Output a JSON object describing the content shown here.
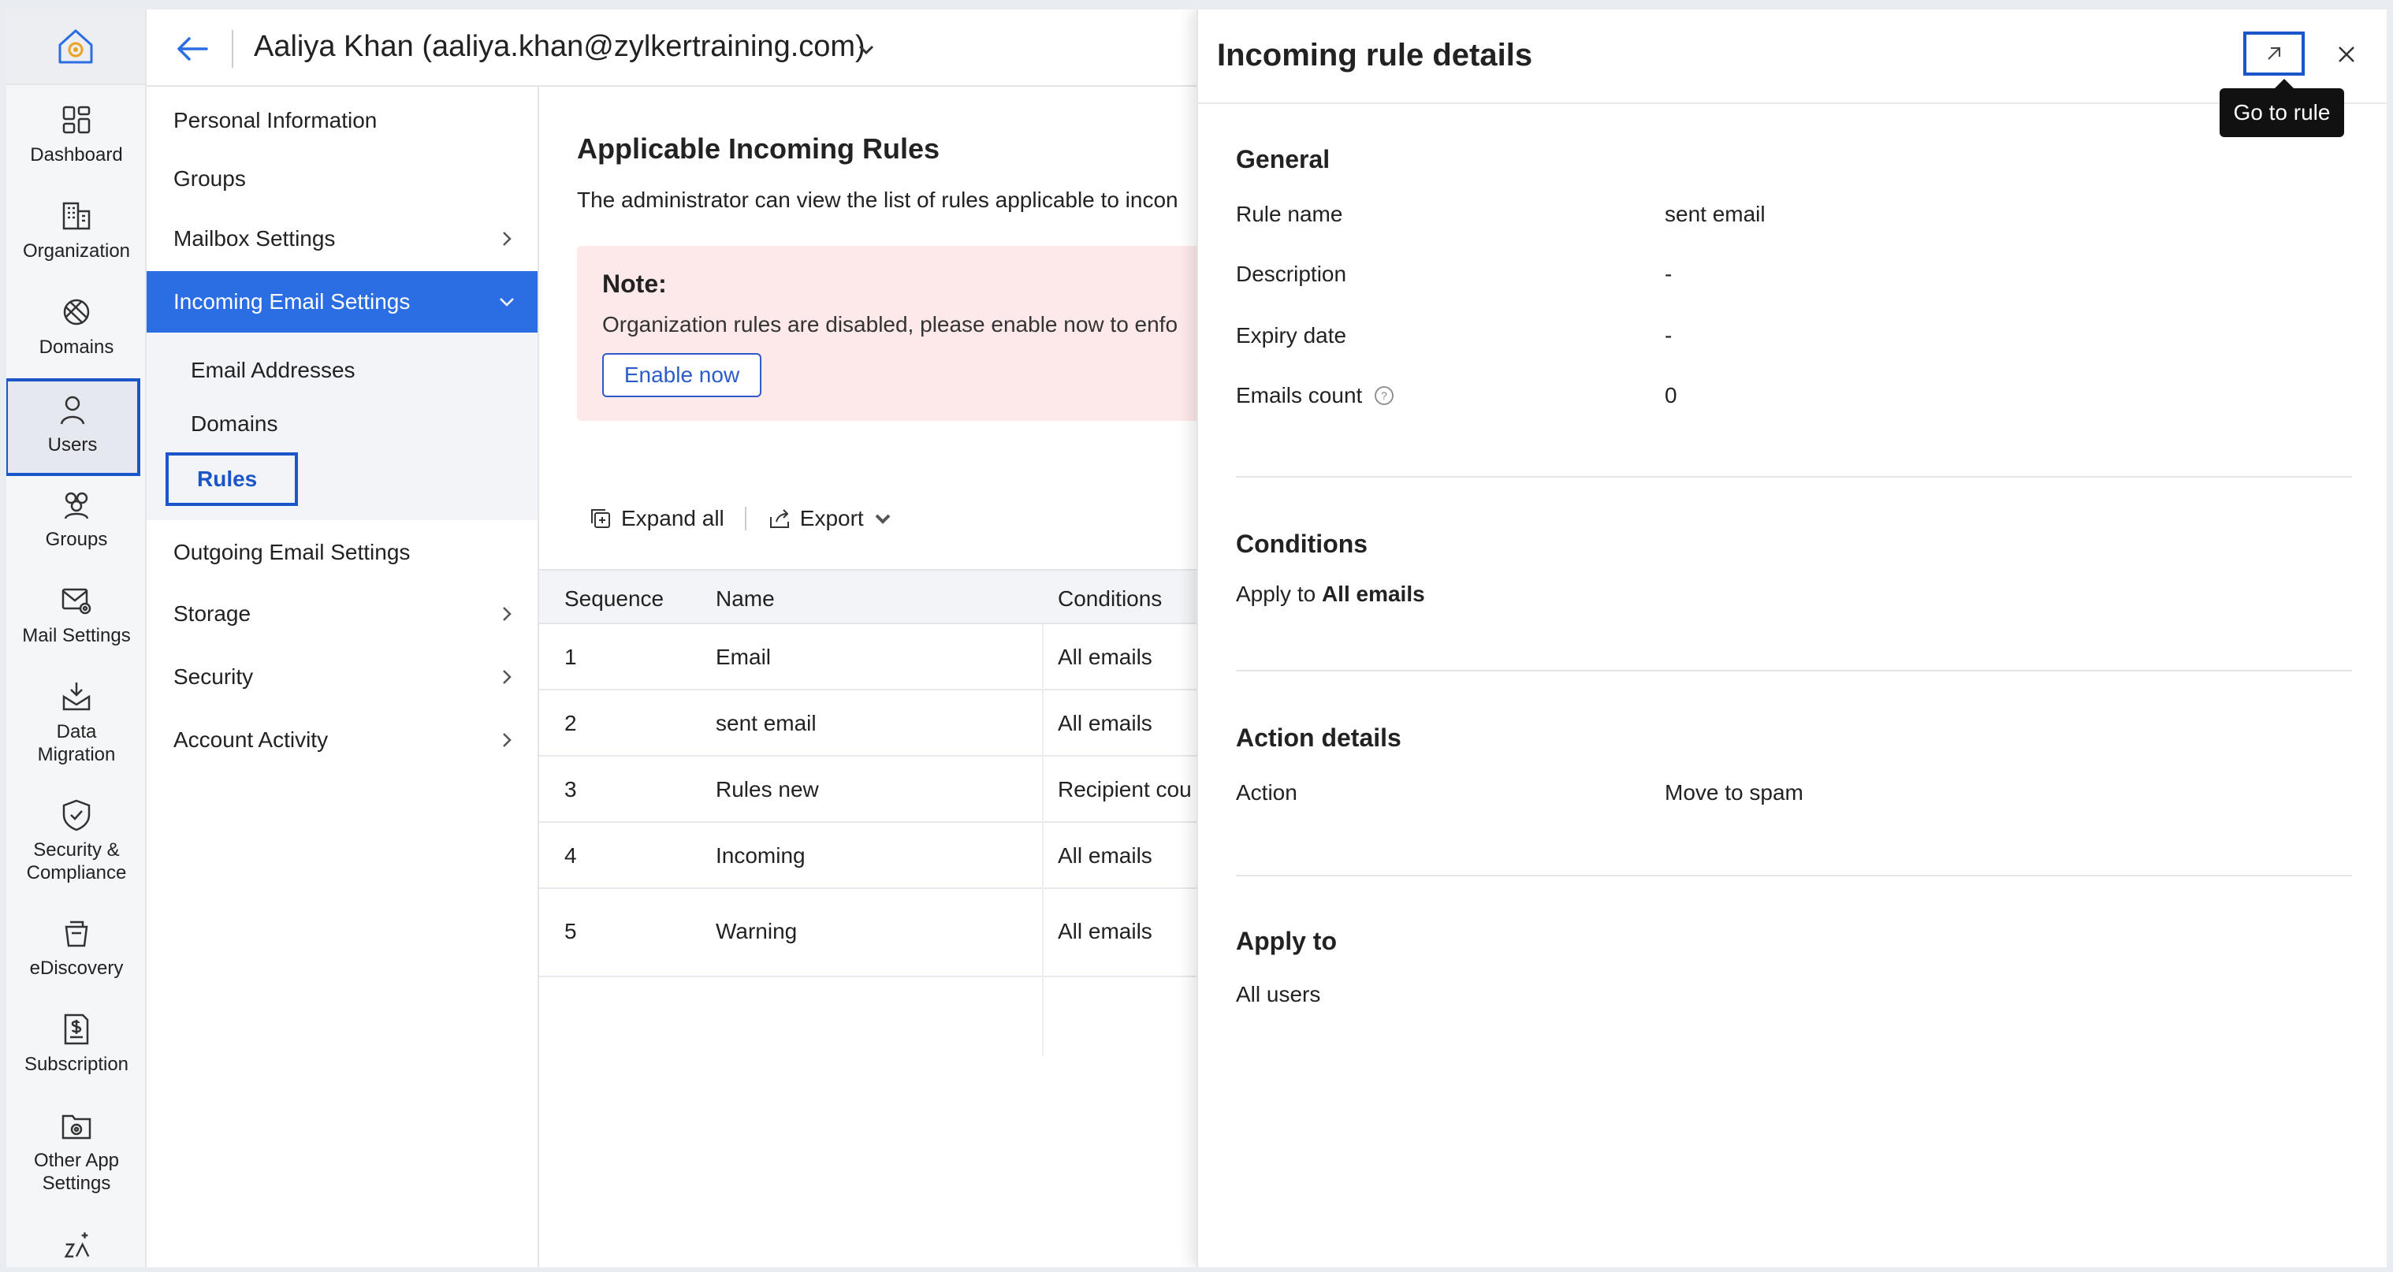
{
  "rail": {
    "items": [
      {
        "label": "Dashboard",
        "icon": "dashboard-icon"
      },
      {
        "label": "Organization",
        "icon": "organization-icon"
      },
      {
        "label": "Domains",
        "icon": "globe-icon"
      },
      {
        "label": "Users",
        "icon": "user-icon"
      },
      {
        "label": "Groups",
        "icon": "groups-icon"
      },
      {
        "label": "Mail Settings",
        "icon": "mail-settings-icon"
      },
      {
        "label": "Data\nMigration",
        "icon": "data-migration-icon"
      },
      {
        "label": "Security &\nCompliance",
        "icon": "shield-check-icon"
      },
      {
        "label": "eDiscovery",
        "icon": "ediscovery-icon"
      },
      {
        "label": "Subscription",
        "icon": "subscription-icon"
      },
      {
        "label": "Other App\nSettings",
        "icon": "app-settings-icon"
      }
    ],
    "active": "Users"
  },
  "header": {
    "title": "Aaliya Khan (aaliya.khan@zylkertraining.com)"
  },
  "subnav": {
    "personal_information": "Personal Information",
    "groups": "Groups",
    "mailbox_settings": "Mailbox Settings",
    "incoming_email_settings": "Incoming Email Settings",
    "email_addresses": "Email Addresses",
    "domains": "Domains",
    "rules": "Rules",
    "outgoing_email_settings": "Outgoing Email Settings",
    "storage": "Storage",
    "security": "Security",
    "account_activity": "Account Activity"
  },
  "main": {
    "title": "Applicable Incoming Rules",
    "description": "The administrator can view the list of rules applicable to incon",
    "note_title": "Note:",
    "note_text": "Organization rules are disabled, please enable now to enfo",
    "enable_now": "Enable now",
    "expand_all": "Expand all",
    "export": "Export",
    "columns": [
      "Sequence",
      "Name",
      "Conditions"
    ],
    "rows": [
      {
        "sequence": "1",
        "name": "Email",
        "conditions": "All emails"
      },
      {
        "sequence": "2",
        "name": "sent email",
        "conditions": "All emails"
      },
      {
        "sequence": "3",
        "name": "Rules new",
        "conditions": "Recipient cou"
      },
      {
        "sequence": "4",
        "name": "Incoming",
        "conditions": "All emails"
      },
      {
        "sequence": "5",
        "name": "Warning",
        "conditions": "All emails"
      }
    ]
  },
  "panel": {
    "title": "Incoming rule details",
    "tooltip": "Go to rule",
    "general": {
      "title": "General",
      "rule_name_label": "Rule name",
      "rule_name_value": "sent email",
      "description_label": "Description",
      "description_value": "-",
      "expiry_label": "Expiry date",
      "expiry_value": "-",
      "emails_count_label": "Emails count",
      "emails_count_value": "0"
    },
    "conditions": {
      "title": "Conditions",
      "apply_prefix": "Apply to",
      "apply_value": "All emails"
    },
    "action_details": {
      "title": "Action details",
      "action_label": "Action",
      "action_value": "Move to spam"
    },
    "apply_to": {
      "title": "Apply to",
      "value": "All users"
    }
  },
  "colors": {
    "accent": "#2b6de3",
    "highlight_border": "#1a56c9",
    "note_bg": "#fde8ea"
  }
}
